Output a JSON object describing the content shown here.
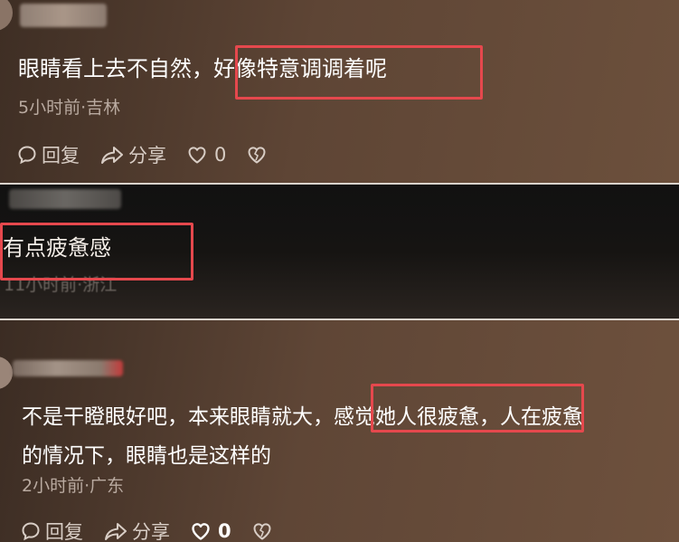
{
  "comments": [
    {
      "text_before": "眼睛看上去不自然，",
      "text_highlight": "好像特意调调着呢",
      "meta": "5小时前·吉林",
      "reply_label": "回复",
      "share_label": "分享",
      "like_count": "0"
    },
    {
      "text_highlight": "有点疲惫感",
      "meta": "11小时前·浙江"
    },
    {
      "line1_before": "不是干瞪眼好吧，本来眼睛就大，",
      "line1_highlight": "感觉她人很疲惫，",
      "line1_after": "人在疲惫",
      "line2": "的情况下，眼睛也是这样的",
      "meta": "2小时前·广东",
      "reply_label": "回复",
      "share_label": "分享",
      "like_count": "0"
    }
  ],
  "colors": {
    "highlight_border": "#e5484d",
    "meta_text": "#b9aaa0",
    "comment_text": "#ffffff"
  },
  "icons": [
    "comment-bubble-icon",
    "share-arrow-icon",
    "heart-icon",
    "broken-heart-icon"
  ]
}
